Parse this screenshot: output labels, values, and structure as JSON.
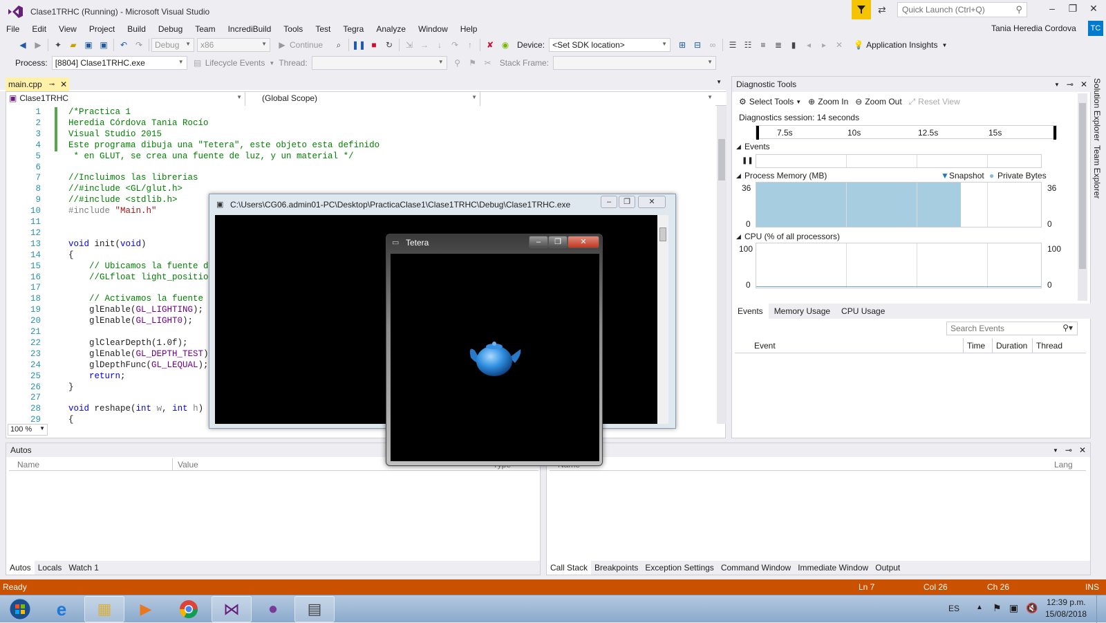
{
  "window": {
    "title": "Clase1TRHC (Running) - Microsoft Visual Studio",
    "quick_launch_placeholder": "Quick Launch (Ctrl+Q)",
    "user": "Tania Heredia Cordova",
    "avatar": "TC"
  },
  "menu": [
    "File",
    "Edit",
    "View",
    "Project",
    "Build",
    "Debug",
    "Team",
    "IncrediBuild",
    "Tools",
    "Test",
    "Tegra",
    "Analyze",
    "Window",
    "Help"
  ],
  "toolbar": {
    "config": "Debug",
    "platform": "x86",
    "continue_label": "Continue",
    "device_label": "Device:",
    "device_value": "<Set SDK location>",
    "app_insights": "Application Insights"
  },
  "toolbar2": {
    "process_label": "Process:",
    "process_value": "[8804] Clase1TRHC.exe",
    "lifecycle": "Lifecycle Events",
    "thread_label": "Thread:",
    "stackframe_label": "Stack Frame:"
  },
  "editor": {
    "tab": "main.cpp",
    "project_combo": "Clase1TRHC",
    "scope_combo": "(Global Scope)",
    "zoom": "100 %",
    "lines": [
      {
        "n": "1",
        "t": "/*Practica 1",
        "c": "green"
      },
      {
        "n": "2",
        "t": "Heredia Córdova Tania Rocío",
        "c": "green"
      },
      {
        "n": "3",
        "t": "Visual Studio 2015",
        "c": "green"
      },
      {
        "n": "4",
        "t": "Este programa dibuja una \"Tetera\", este objeto esta definido",
        "c": "green"
      },
      {
        "n": "5",
        "t": " * en GLUT, se crea una fuente de luz, y un material */",
        "c": "green"
      },
      {
        "n": "6",
        "t": "",
        "c": ""
      },
      {
        "n": "7",
        "t": "//Incluimos las librerias",
        "c": "green"
      },
      {
        "n": "8",
        "t": "//#include <GL/glut.h>",
        "c": "green"
      },
      {
        "n": "9",
        "t": "//#include <stdlib.h>",
        "c": "green"
      },
      {
        "n": "10",
        "t": "#include \"Main.h\"",
        "c": "mixed_include"
      },
      {
        "n": "11",
        "t": "",
        "c": ""
      },
      {
        "n": "12",
        "t": "",
        "c": ""
      },
      {
        "n": "13",
        "t": "void init(void)",
        "c": "mixed_void"
      },
      {
        "n": "14",
        "t": "{",
        "c": ""
      },
      {
        "n": "15",
        "t": "    // Ubicamos la fuente de",
        "c": "green"
      },
      {
        "n": "16",
        "t": "    //GLfloat light_position",
        "c": "green"
      },
      {
        "n": "17",
        "t": "",
        "c": ""
      },
      {
        "n": "18",
        "t": "    // Activamos la fuente d",
        "c": "green"
      },
      {
        "n": "19",
        "t": "    glEnable(GL_LIGHTING);",
        "c": "mixed_gl"
      },
      {
        "n": "20",
        "t": "    glEnable(GL_LIGHT0);",
        "c": "mixed_gl"
      },
      {
        "n": "21",
        "t": "",
        "c": ""
      },
      {
        "n": "22",
        "t": "    glClearDepth(1.0f);",
        "c": ""
      },
      {
        "n": "23",
        "t": "    glEnable(GL_DEPTH_TEST);",
        "c": "mixed_gl"
      },
      {
        "n": "24",
        "t": "    glDepthFunc(GL_LEQUAL);",
        "c": "mixed_gl"
      },
      {
        "n": "25",
        "t": "    return;",
        "c": "blue"
      },
      {
        "n": "26",
        "t": "}",
        "c": ""
      },
      {
        "n": "27",
        "t": "",
        "c": ""
      },
      {
        "n": "28",
        "t": "void reshape(int w, int h)",
        "c": "mixed_void"
      },
      {
        "n": "29",
        "t": "{",
        "c": ""
      }
    ]
  },
  "diag": {
    "title": "Diagnostic Tools",
    "select_tools": "Select Tools",
    "zoom_in": "Zoom In",
    "zoom_out": "Zoom Out",
    "reset_view": "Reset View",
    "session": "Diagnostics session: 14 seconds",
    "ticks": [
      "7.5s",
      "10s",
      "12.5s",
      "15s"
    ],
    "events_label": "Events",
    "memory_label": "Process Memory (MB)",
    "snapshot": "Snapshot",
    "private_bytes": "Private Bytes",
    "mem_max": "36",
    "mem_min": "0",
    "cpu_label": "CPU (% of all processors)",
    "cpu_max": "100",
    "cpu_min": "0",
    "tabs": [
      "Events",
      "Memory Usage",
      "CPU Usage"
    ],
    "search_placeholder": "Search Events",
    "columns": [
      "Event",
      "Time",
      "Duration",
      "Thread"
    ]
  },
  "chart_data": {
    "type": "area",
    "title": "Process Memory (MB)",
    "series": [
      {
        "name": "Private Bytes",
        "x": [
          "5s",
          "7.5s",
          "10s",
          "12.5s",
          "14s"
        ],
        "values": [
          36,
          36,
          36,
          36,
          36
        ]
      }
    ],
    "ylim": [
      0,
      36
    ]
  },
  "side_tabs": [
    "Solution Explorer",
    "Team Explorer"
  ],
  "autos": {
    "title": "Autos",
    "columns": [
      "Name",
      "Value",
      "Type"
    ],
    "tabs": [
      "Autos",
      "Locals",
      "Watch 1"
    ]
  },
  "callstack": {
    "columns": [
      "Name",
      "Lang"
    ],
    "tabs": [
      "Call Stack",
      "Breakpoints",
      "Exception Settings",
      "Command Window",
      "Immediate Window",
      "Output"
    ]
  },
  "status": {
    "ready": "Ready",
    "ln": "Ln 7",
    "col": "Col 26",
    "ch": "Ch 26",
    "ins": "INS"
  },
  "console": {
    "title": "C:\\Users\\CG06.admin01-PC\\Desktop\\PracticaClase1\\Clase1TRHC\\Debug\\Clase1TRHC.exe"
  },
  "teapot": {
    "title": "Tetera"
  },
  "taskbar": {
    "lang": "ES",
    "time": "12:39 p.m.",
    "date": "15/08/2018"
  },
  "colors": {
    "accent": "#007acc",
    "status": "#ca5100",
    "memory_fill": "#a6cde0"
  }
}
